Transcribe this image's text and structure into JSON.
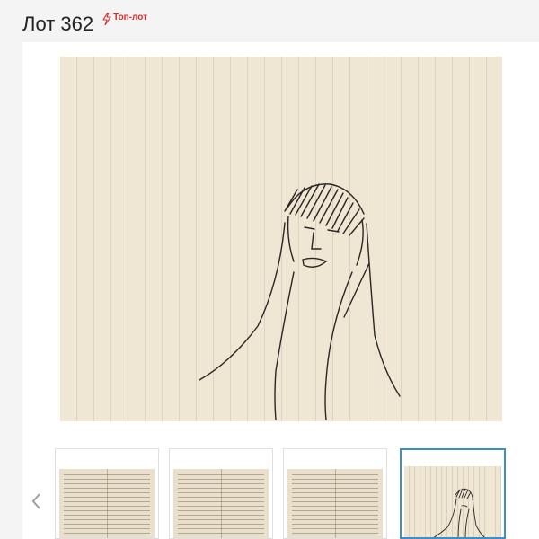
{
  "lot": {
    "title": "Лот 362",
    "badge_label": "Топ-лот",
    "badge_icon": "lightning-icon"
  },
  "colors": {
    "badge": "#d32f2f",
    "paper": "#efe6d4",
    "active_thumb_border": "#3d8ec9"
  },
  "gallery": {
    "prev_icon": "chevron-left-icon",
    "active_index": 3,
    "thumbnails": [
      {
        "kind": "manuscript-spread"
      },
      {
        "kind": "manuscript-spread"
      },
      {
        "kind": "manuscript-spread"
      },
      {
        "kind": "drawing"
      }
    ]
  }
}
